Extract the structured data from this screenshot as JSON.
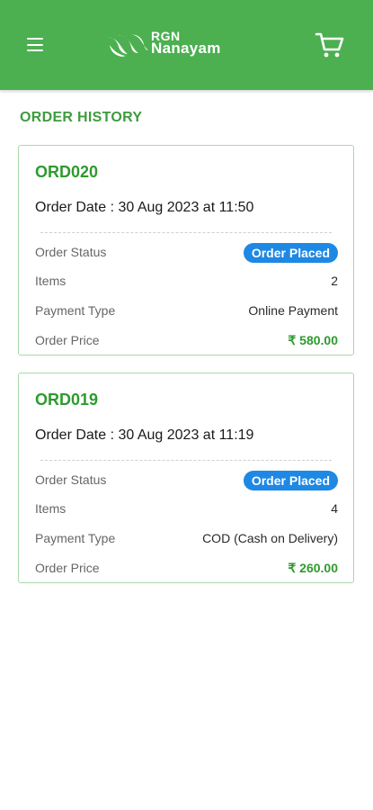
{
  "header": {
    "brand_line1": "RGN",
    "brand_line2": "Nanayam",
    "menu_icon": "hamburger-menu-icon",
    "cart_icon": "shopping-cart-icon",
    "background_color": "#4caf50"
  },
  "page": {
    "title": "ORDER HISTORY"
  },
  "labels": {
    "status": "Order Status",
    "items": "Items",
    "payment": "Payment Type",
    "price": "Order Price"
  },
  "orders": [
    {
      "id": "ORD020",
      "date": "Order Date : 30 Aug 2023 at 11:50",
      "status": "Order Placed",
      "items": "2",
      "payment": "Online Payment",
      "price": "₹ 580.00"
    },
    {
      "id": "ORD019",
      "date": "Order Date : 30 Aug 2023 at 11:19",
      "status": "Order Placed",
      "items": "4",
      "payment": "COD (Cash on Delivery)",
      "price": "₹ 260.00"
    }
  ],
  "colors": {
    "accent_green": "#2e9a2e",
    "status_blue": "#1e88e5"
  }
}
